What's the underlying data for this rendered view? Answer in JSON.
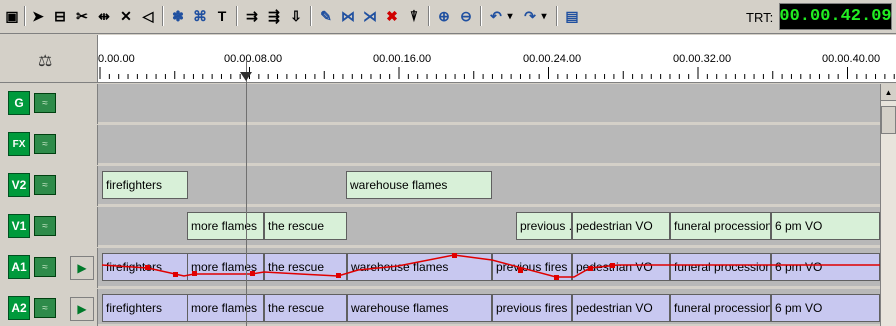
{
  "toolbar": {
    "buttons": [
      {
        "name": "save-icon",
        "glyph": "▣"
      },
      {
        "name": "pointer-icon",
        "glyph": "➤"
      },
      {
        "name": "select-clip-icon",
        "glyph": "⊟"
      },
      {
        "name": "razor-icon",
        "glyph": "✂"
      },
      {
        "name": "split-icon",
        "glyph": "⇹"
      },
      {
        "name": "delete-x-icon",
        "glyph": "✕"
      },
      {
        "name": "audio-volume-icon",
        "glyph": "◁"
      },
      {
        "name": "effects-icon",
        "glyph": "✽"
      },
      {
        "name": "transition-icon",
        "glyph": "⌘"
      },
      {
        "name": "text-tool-icon",
        "glyph": "T"
      },
      {
        "name": "move-forward-icon",
        "glyph": "⇉"
      },
      {
        "name": "move-backward-icon",
        "glyph": "⇶"
      },
      {
        "name": "ripple-icon",
        "glyph": "⇩"
      },
      {
        "name": "link-icon",
        "glyph": "✎"
      },
      {
        "name": "group-icon",
        "glyph": "⋈"
      },
      {
        "name": "ungroup-icon",
        "glyph": "⋊"
      },
      {
        "name": "remove-red-x-icon",
        "glyph": "✖"
      },
      {
        "name": "insert-marker-icon",
        "glyph": "⍒"
      },
      {
        "name": "zoom-in-icon",
        "glyph": "⊕"
      },
      {
        "name": "zoom-out-icon",
        "glyph": "⊖"
      },
      {
        "name": "undo-icon",
        "glyph": "↶"
      },
      {
        "name": "undo-dropdown-icon",
        "glyph": "▾"
      },
      {
        "name": "redo-icon",
        "glyph": "↷"
      },
      {
        "name": "redo-dropdown-icon",
        "glyph": "▾"
      },
      {
        "name": "settings-icon",
        "glyph": "▤"
      }
    ],
    "trt_label": "TRT:",
    "trt_value": "00.00.42.09"
  },
  "ruler": {
    "corner_glyph": "⚖",
    "labels": [
      "0.00.00",
      "00.00.08.00",
      "00.00.16.00",
      "00.00.24.00",
      "00.00.32.00",
      "00.00.40.00"
    ]
  },
  "tracks": [
    {
      "id": "G",
      "label": "G",
      "clips": []
    },
    {
      "id": "FX",
      "label": "FX",
      "clips": []
    },
    {
      "id": "V2",
      "label": "V2",
      "clips": [
        {
          "text": "firefighters"
        },
        {
          "text": "warehouse flames"
        }
      ]
    },
    {
      "id": "V1",
      "label": "V1",
      "clips": [
        {
          "text": "more flames"
        },
        {
          "text": "the rescue"
        },
        {
          "text": "previous ..."
        },
        {
          "text": "pedestrian VO"
        },
        {
          "text": "funeral procession"
        },
        {
          "text": "6 pm VO"
        }
      ]
    },
    {
      "id": "A1",
      "label": "A1",
      "clips": [
        {
          "text": "firefighters"
        },
        {
          "text": "more flames"
        },
        {
          "text": "the rescue"
        },
        {
          "text": "warehouse flames"
        },
        {
          "text": "previous fires"
        },
        {
          "text": "pedestrian VO"
        },
        {
          "text": "funeral procession"
        },
        {
          "text": "6 pm VO"
        }
      ]
    },
    {
      "id": "A2",
      "label": "A2",
      "clips": [
        {
          "text": "firefighters"
        },
        {
          "text": "more flames"
        },
        {
          "text": "the rescue"
        },
        {
          "text": "warehouse flames"
        },
        {
          "text": "previous fires"
        },
        {
          "text": "pedestrian VO"
        },
        {
          "text": "funeral procession"
        },
        {
          "text": "6 pm VO"
        }
      ]
    }
  ]
}
